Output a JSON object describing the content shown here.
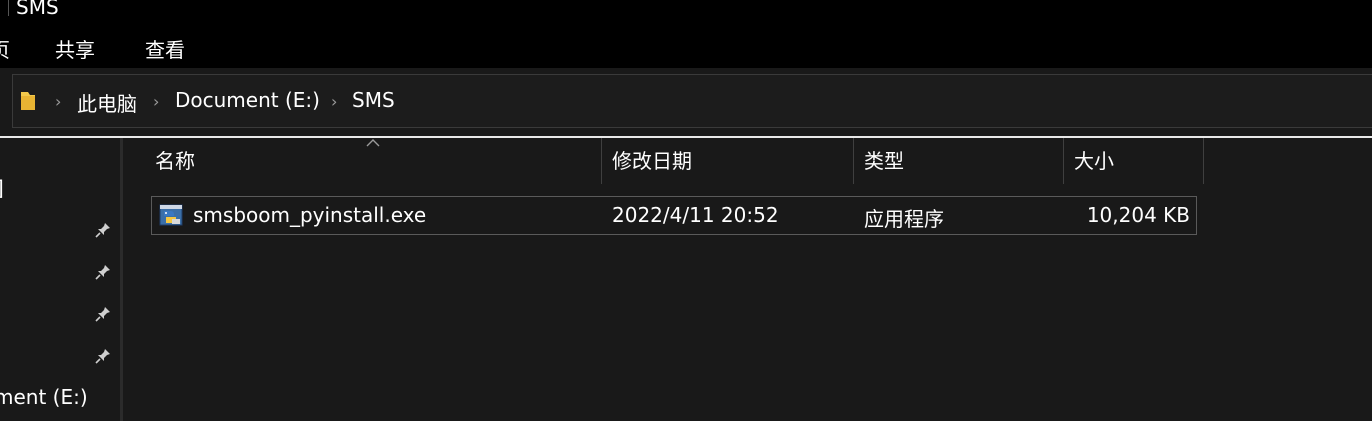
{
  "window": {
    "title": "SMS"
  },
  "ribbon": {
    "tabs": [
      "页",
      "共享",
      "查看"
    ]
  },
  "address": {
    "crumbs": [
      "此电脑",
      "Document (E:)",
      "SMS"
    ],
    "separator": "›"
  },
  "nav": {
    "fragment_top": "]",
    "fragment_drive": "ment (E:)",
    "pins": [
      "pin-icon",
      "pin-icon",
      "pin-icon",
      "pin-icon"
    ]
  },
  "columns": {
    "name": "名称",
    "modified": "修改日期",
    "type": "类型",
    "size": "大小"
  },
  "files": [
    {
      "name": "smsboom_pyinstall.exe",
      "modified": "2022/4/11 20:52",
      "type": "应用程序",
      "size": "10,204 KB",
      "icon": "python-exe-icon"
    }
  ],
  "colors": {
    "background": "#191919",
    "chrome": "#000000",
    "text": "#ffffff",
    "folder": "#f2c84b"
  }
}
